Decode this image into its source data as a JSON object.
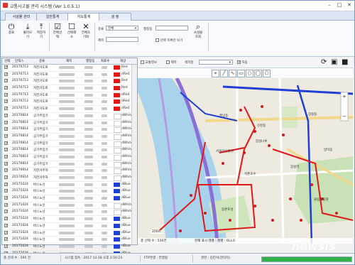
{
  "window": {
    "title": "교통사고물 관리 시스템 (Ver 1.0.5.1)",
    "min": "–",
    "max": "□",
    "close": "✕"
  },
  "tabs": [
    {
      "label": "사설물 관리"
    },
    {
      "label": "일반통계"
    },
    {
      "label": "지도통계"
    },
    {
      "label": "설 정"
    }
  ],
  "ribbon": {
    "buttons": [
      {
        "icon": "⏻",
        "label": "종료"
      },
      {
        "icon": "⤓",
        "label": "불러오기"
      },
      {
        "icon": "⤒",
        "label": "저장하기"
      },
      {
        "icon": "☑",
        "label": "전체선택"
      },
      {
        "icon": "☐",
        "label": "선택해소"
      },
      {
        "icon": "✕",
        "label": "전체초기화"
      }
    ],
    "filter": {
      "type_label": "종류",
      "type_value": "전체",
      "dong_label": "행정동",
      "dong_value": "",
      "name_label": "제목",
      "name_value": "",
      "show_selected_label": "선택 목록만 보기",
      "search_label": "사설물 조회",
      "group_label": "사설물 검색"
    }
  },
  "table": {
    "headers": [
      "선택",
      "인덱스",
      "종류",
      "제목",
      "행정동",
      "좌표수",
      "색상"
    ],
    "rows": [
      {
        "checked": true,
        "index": "20170713",
        "kind": "자전거도로",
        "color_hex": "#e01818",
        "color": "Red"
      },
      {
        "checked": true,
        "index": "20170713",
        "kind": "자전거도로",
        "color_hex": "#e01818",
        "color": "dRed"
      },
      {
        "checked": true,
        "index": "20170713",
        "kind": "자전거도로",
        "color_hex": "#e01818",
        "color": "Red"
      },
      {
        "checked": true,
        "index": "20170713",
        "kind": "자전거도로",
        "color_hex": "#e01818",
        "color": "Red"
      },
      {
        "checked": true,
        "index": "20170713",
        "kind": "자전거도로",
        "color_hex": "#e01818",
        "color": "dRed"
      },
      {
        "checked": true,
        "index": "20170713",
        "kind": "자전거도로",
        "color_hex": "#e01818",
        "color": "dRed"
      },
      {
        "checked": true,
        "index": "20170713",
        "kind": "자전거도로",
        "color_hex": "#e01818",
        "color": "dRed"
      },
      {
        "checked": true,
        "index": "20170814",
        "kind": "공기주입기",
        "color_hex": "#ffffff",
        "color": "dWhite"
      },
      {
        "checked": true,
        "index": "20170814",
        "kind": "공기주입기",
        "color_hex": "#ffffff",
        "color": "dWhite"
      },
      {
        "checked": true,
        "index": "20170814",
        "kind": "공기주입기",
        "color_hex": "#ffffff",
        "color": "dWhite"
      },
      {
        "checked": true,
        "index": "20170814",
        "kind": "공기주입기",
        "color_hex": "#ffffff",
        "color": "dWhite"
      },
      {
        "checked": true,
        "index": "20170814",
        "kind": "공기주입기",
        "color_hex": "#ffffff",
        "color": "dWhite"
      },
      {
        "checked": true,
        "index": "20170814",
        "kind": "공기주입기",
        "color_hex": "#ffffff",
        "color": "dWhite"
      },
      {
        "checked": true,
        "index": "20170814",
        "kind": "공기주입기",
        "color_hex": "#ffffff",
        "color": "dWhite"
      },
      {
        "checked": true,
        "index": "20170814",
        "kind": "공기주입기",
        "color_hex": "#ffffff",
        "color": "dWhite"
      },
      {
        "checked": true,
        "index": "20170914",
        "kind": "자전거주차",
        "color_hex": "#ffffff",
        "color": "dWhite"
      },
      {
        "checked": true,
        "index": "20170914",
        "kind": "자전거주차",
        "color_hex": "#ffffff",
        "color": "dWhite"
      },
      {
        "checked": true,
        "index": "20171024",
        "kind": "버스노선",
        "color_hex": "#1f3fd6",
        "color": "dBlue"
      },
      {
        "checked": true,
        "index": "20171024",
        "kind": "버스노선",
        "color_hex": "#1f3fd6",
        "color": "dBlue"
      },
      {
        "checked": true,
        "index": "20171024",
        "kind": "버스노선",
        "color_hex": "#1f3fd6",
        "color": "dBlue"
      },
      {
        "checked": true,
        "index": "20171024",
        "kind": "버스노선",
        "color_hex": "#ffffff",
        "color": "dWhite"
      },
      {
        "checked": true,
        "index": "20171024",
        "kind": "버스노선",
        "color_hex": "#ffffff",
        "color": "dWhite"
      },
      {
        "checked": true,
        "index": "20171024",
        "kind": "버스노선",
        "color_hex": "#1f3fd6",
        "color": "dBlue"
      },
      {
        "checked": true,
        "index": "20171024",
        "kind": "버스노선",
        "color_hex": "#1f3fd6",
        "color": "dBlue"
      },
      {
        "checked": true,
        "index": "20171024",
        "kind": "버스노선",
        "color_hex": "#1f3fd6",
        "color": "dBlue"
      },
      {
        "checked": true,
        "index": "20171024",
        "kind": "버스노선",
        "color_hex": "#1f3fd6",
        "color": "dBlue"
      },
      {
        "checked": true,
        "index": "20171024",
        "kind": "버스노선",
        "color_hex": "#1f3fd6",
        "color": "dBlue"
      },
      {
        "checked": true,
        "index": "20171024",
        "kind": "버스노선",
        "color_hex": "#1f3fd6",
        "color": "dBlue"
      }
    ]
  },
  "map_toolbar": {
    "traffic_label": "교통정보",
    "title_label": "제목",
    "color_label": "색지정",
    "auto_label": "자동"
  },
  "map": {
    "labels": [
      "잠실나루",
      "잠실동",
      "잠실역",
      "석촌호수",
      "올림픽공원",
      "몽촌토성",
      "방이동",
      "신천동",
      "서울아산병원",
      "풍납동"
    ],
    "scale": "200m",
    "bottom_left": "총 선택 수 : 530건",
    "bottom_mid": "현재 표시 레벨 : 레벨 : OLL오"
  },
  "statusbar": {
    "total": "총 검색 수 : 595 건",
    "time": "시스템 접속 : 2017-12-18 오후 3:50:23",
    "ftp": "FTP연결 : 연결됨",
    "user": "권한 : 김진석(관리자)",
    "progress_percent": 100
  },
  "watermark": "newsis"
}
